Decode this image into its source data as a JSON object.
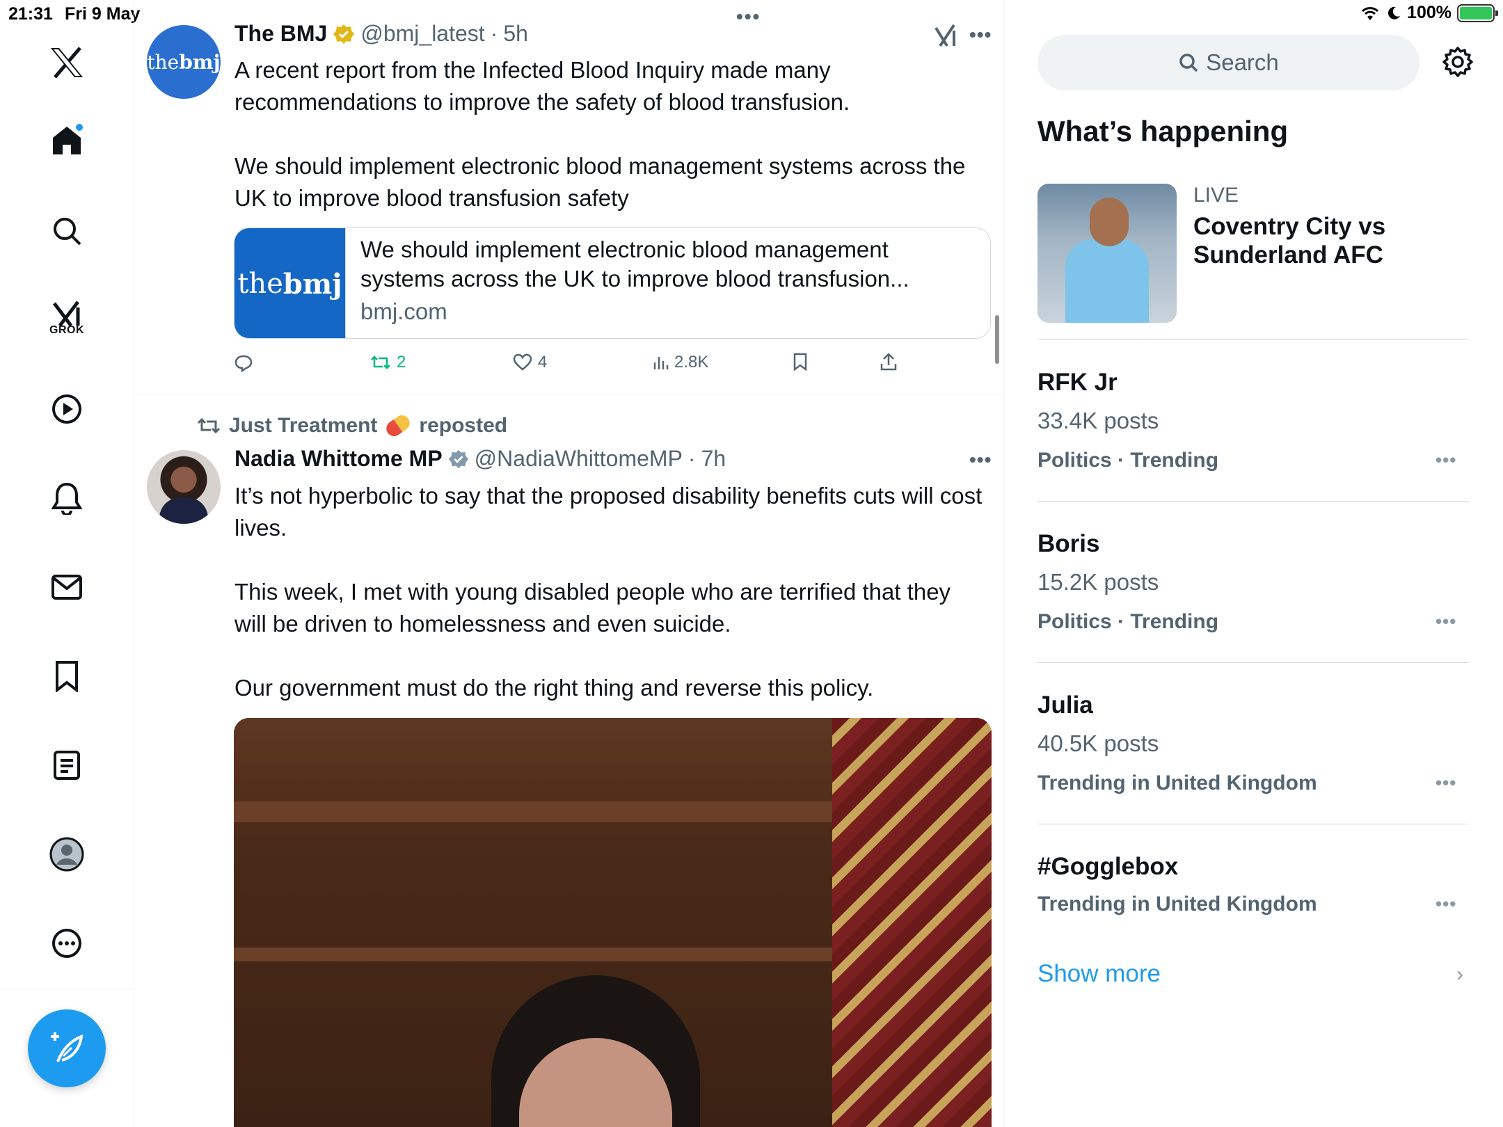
{
  "status_bar": {
    "time": "21:31",
    "date": "Fri 9 May",
    "battery": "100%"
  },
  "nav": {
    "grok_label": "GROK",
    "items": [
      "x-logo",
      "home",
      "explore",
      "grok",
      "video",
      "notifications",
      "messages",
      "bookmarks",
      "lists",
      "profile",
      "more"
    ]
  },
  "tweet1": {
    "name": "The BMJ",
    "handle": "@bmj_latest",
    "sep": "·",
    "time": "5h",
    "avatar_text_a": "the",
    "avatar_text_b": "bmj",
    "text_p1": "A recent report from the Infected Blood Inquiry made many recommendations to improve the safety of blood transfusion.",
    "text_p2": "We should implement electronic blood management systems across the UK to improve blood transfusion safety",
    "card": {
      "img_text_a": "the",
      "img_text_b": "bmj",
      "title": "We should implement electronic blood management systems across the UK to improve blood transfusion...",
      "domain": "bmj.com"
    },
    "actions": {
      "replies": "",
      "reposts": "2",
      "likes": "4",
      "views": "2.8K"
    }
  },
  "tweet2": {
    "repost_by": "Just Treatment",
    "repost_suffix": "reposted",
    "name": "Nadia Whittome MP",
    "handle": "@NadiaWhittomeMP",
    "sep": "·",
    "time": "7h",
    "text_p1": "It’s not hyperbolic to say that the proposed disability benefits cuts will cost lives.",
    "text_p2": "This week, I met with young disabled people who are terrified that they will be driven to homelessness and even suicide.",
    "text_p3": "Our government must do the right thing and reverse this policy."
  },
  "sidebar": {
    "search_placeholder": "Search",
    "section_title": "What’s happening",
    "live": {
      "label": "LIVE",
      "title": "Coventry City vs Sunderland AFC"
    },
    "trends": [
      {
        "name": "RFK Jr",
        "posts": "33.4K posts",
        "context": "Politics · Trending"
      },
      {
        "name": "Boris",
        "posts": "15.2K posts",
        "context": "Politics · Trending"
      },
      {
        "name": "Julia",
        "posts": "40.5K posts",
        "context": "Trending in United Kingdom"
      },
      {
        "name": "#Gogglebox",
        "posts": "",
        "context": "Trending in United Kingdom"
      }
    ],
    "show_more": "Show more"
  },
  "colors": {
    "accent": "#1d9bf0",
    "repost_green": "#00ba7c",
    "verified_gold": "#e2b719",
    "verified_grey": "#829aab"
  }
}
